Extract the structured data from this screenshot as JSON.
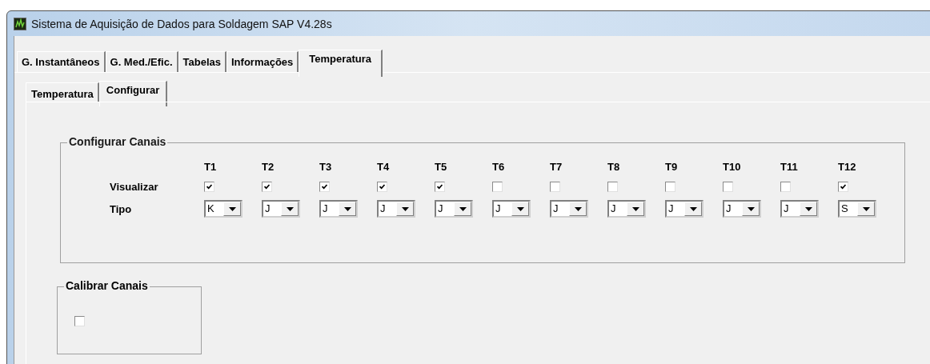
{
  "window": {
    "title": "Sistema de Aquisição de Dados para Soldagem  SAP V4.28s"
  },
  "tabs": [
    {
      "label": "G. Instantâneos",
      "selected": false
    },
    {
      "label": "G.  Med./Efic.",
      "selected": false
    },
    {
      "label": "Tabelas",
      "selected": false
    },
    {
      "label": "Informações",
      "selected": false
    },
    {
      "label": "Temperatura",
      "selected": true
    }
  ],
  "subtabs": [
    {
      "label": "Temperatura",
      "selected": false
    },
    {
      "label": "Configurar",
      "selected": true
    }
  ],
  "channels_group": {
    "title": "Configurar Canais",
    "visible_label": "Visualizar",
    "type_label": "Tipo",
    "channels": [
      {
        "name": "T1",
        "checked": true,
        "type": "K"
      },
      {
        "name": "T2",
        "checked": true,
        "type": "J"
      },
      {
        "name": "T3",
        "checked": true,
        "type": "J"
      },
      {
        "name": "T4",
        "checked": true,
        "type": "J"
      },
      {
        "name": "T5",
        "checked": true,
        "type": "J"
      },
      {
        "name": "T6",
        "checked": false,
        "type": "J"
      },
      {
        "name": "T7",
        "checked": false,
        "type": "J"
      },
      {
        "name": "T8",
        "checked": false,
        "type": "J"
      },
      {
        "name": "T9",
        "checked": false,
        "type": "J"
      },
      {
        "name": "T10",
        "checked": false,
        "type": "J"
      },
      {
        "name": "T11",
        "checked": false,
        "type": "J"
      },
      {
        "name": "T12",
        "checked": true,
        "type": "S"
      }
    ]
  },
  "calibrate_group": {
    "title": "Calibrar Canais",
    "checked": false
  }
}
